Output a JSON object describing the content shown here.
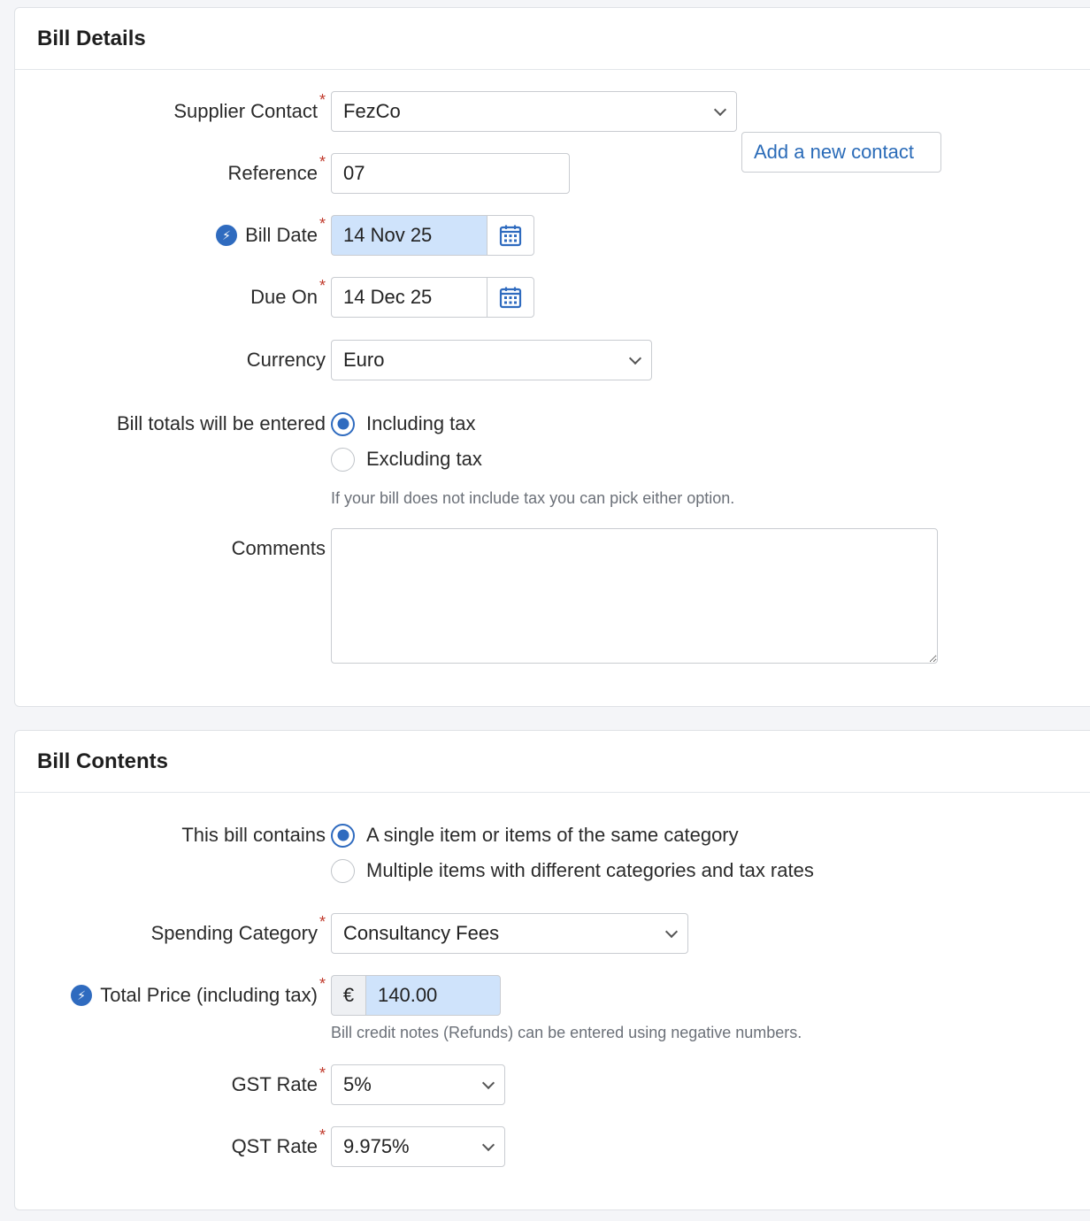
{
  "bill_details": {
    "title": "Bill Details",
    "supplier_contact": {
      "label": "Supplier Contact",
      "value": "FezCo",
      "add_button": "Add a new contact"
    },
    "reference": {
      "label": "Reference",
      "value": "07"
    },
    "bill_date": {
      "label": "Bill Date",
      "value": "14 Nov 25"
    },
    "due_on": {
      "label": "Due On",
      "value": "14 Dec 25"
    },
    "currency": {
      "label": "Currency",
      "value": "Euro"
    },
    "totals": {
      "label": "Bill totals will be entered",
      "options": [
        "Including tax",
        "Excluding tax"
      ],
      "selected": "Including tax",
      "help": "If your bill does not include tax you can pick either option."
    },
    "comments": {
      "label": "Comments",
      "value": ""
    }
  },
  "bill_contents": {
    "title": "Bill Contents",
    "contains": {
      "label": "This bill contains",
      "options": [
        "A single item or items of the same category",
        "Multiple items with different categories and tax rates"
      ],
      "selected": "A single item or items of the same category"
    },
    "spending_category": {
      "label": "Spending Category",
      "value": "Consultancy Fees"
    },
    "total_price": {
      "label": "Total Price (including tax)",
      "currency_symbol": "€",
      "value": "140.00",
      "help": "Bill credit notes (Refunds) can be entered using negative numbers."
    },
    "gst_rate": {
      "label": "GST Rate",
      "value": "5%"
    },
    "qst_rate": {
      "label": "QST Rate",
      "value": "9.975%"
    }
  },
  "icons": {
    "required_mark": "*",
    "bolt": "⚡",
    "calendar": "calendar-icon",
    "chevron": "chevron-down-icon"
  },
  "colors": {
    "accent": "#2f6bbf",
    "highlight": "#cfe3fb",
    "required": "#c0392b"
  }
}
